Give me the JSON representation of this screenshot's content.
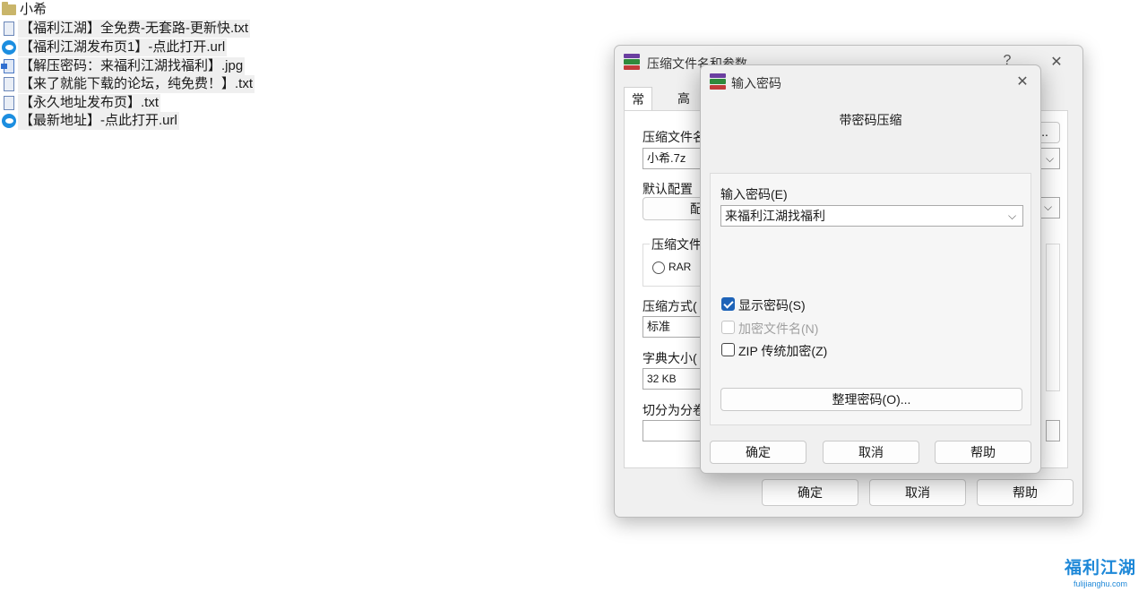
{
  "files": [
    {
      "icon": "folder-icon",
      "name": "小希",
      "highlight": false
    },
    {
      "icon": "text-file-icon",
      "name": "【福利江湖】全免费-无套路-更新快.txt",
      "highlight": true
    },
    {
      "icon": "edge-url-icon",
      "name": "【福利江湖发布页1】-点此打开.url",
      "highlight": true
    },
    {
      "icon": "image-file-icon",
      "name": "【解压密码：来福利江湖找福利】.jpg",
      "highlight": true
    },
    {
      "icon": "text-file-icon",
      "name": "【来了就能下载的论坛，纯免费！】.txt",
      "highlight": true
    },
    {
      "icon": "text-file-icon",
      "name": "【永久地址发布页】.txt",
      "highlight": true
    },
    {
      "icon": "edge-url-icon",
      "name": "【最新地址】-点此打开.url",
      "highlight": true
    }
  ],
  "archive_dialog": {
    "title": "压缩文件名和参数",
    "help_glyph": "?",
    "close_glyph": "✕",
    "tabs": [
      "常规",
      "高级"
    ],
    "archive_name_label": "压缩文件名",
    "archive_name_value": "小希.7z",
    "default_profile_label": "默认配置",
    "profile_button": "配",
    "format_group_label": "压缩文件",
    "format_rar": "RAR",
    "method_label": "压缩方式(",
    "method_value": "标准",
    "dict_label": "字典大小(",
    "dict_value": "32 KB",
    "split_label": "切分为分卷",
    "browse_button": "..",
    "ok": "确定",
    "cancel": "取消",
    "help": "帮助"
  },
  "password_dialog": {
    "title": "输入密码",
    "close_glyph": "✕",
    "heading": "带密码压缩",
    "password_label": "输入密码(E)",
    "password_value": "来福利江湖找福利",
    "show_password": {
      "label": "显示密码(S)",
      "checked": true,
      "enabled": true
    },
    "encrypt_names": {
      "label": "加密文件名(N)",
      "checked": false,
      "enabled": false
    },
    "zip_legacy": {
      "label": "ZIP 传统加密(Z)",
      "checked": false,
      "enabled": true
    },
    "organize_button": "整理密码(O)...",
    "ok": "确定",
    "cancel": "取消",
    "help": "帮助"
  },
  "watermark": {
    "title": "福利江湖",
    "url": "fulijianghu.com"
  },
  "colors": {
    "accent": "#1e63b8",
    "watermark": "#1e88d8",
    "dialog_bg": "#f0f0f0"
  }
}
